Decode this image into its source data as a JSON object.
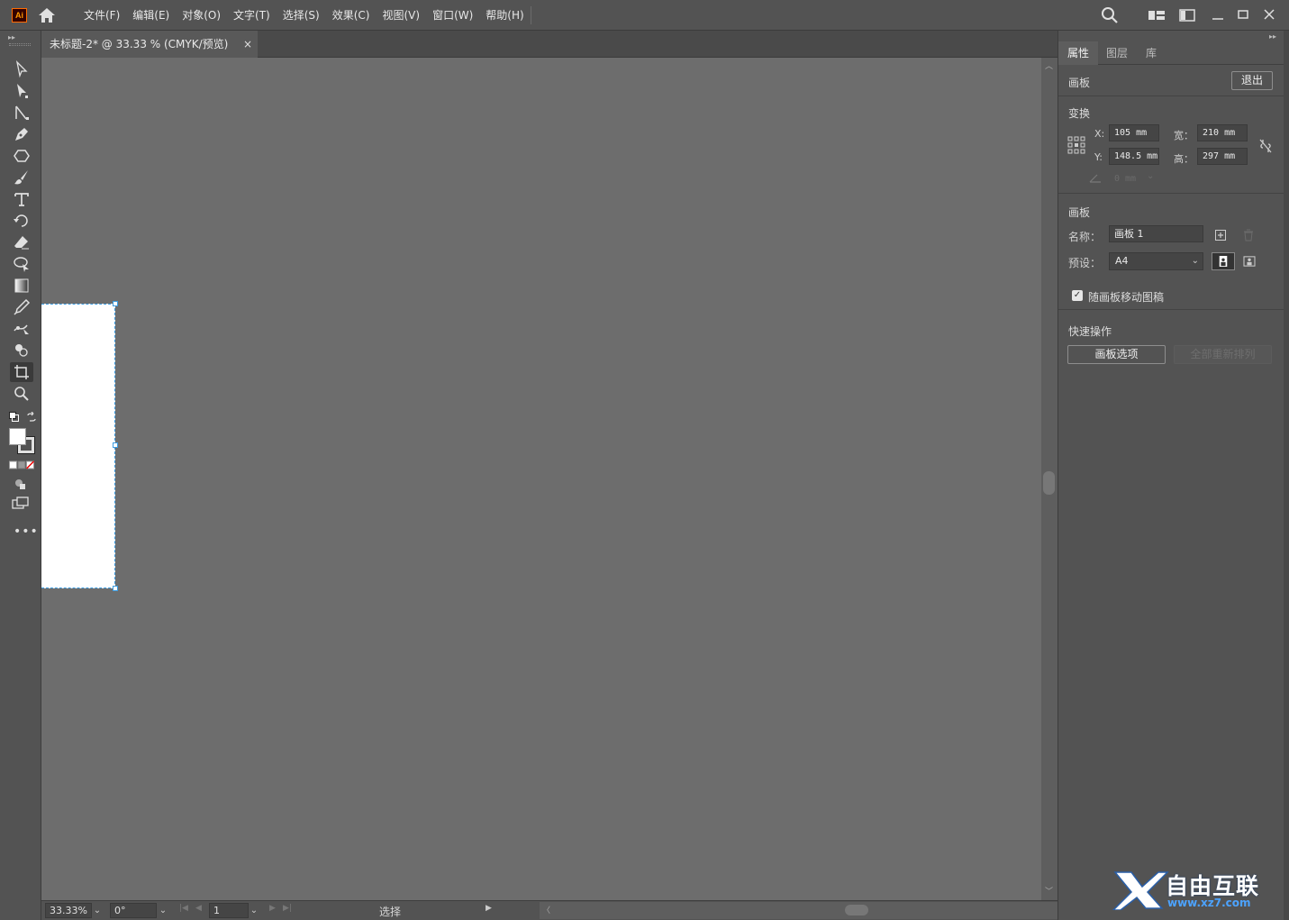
{
  "app": {
    "logo_text": "Ai"
  },
  "menu": {
    "items": [
      "文件(F)",
      "编辑(E)",
      "对象(O)",
      "文字(T)",
      "选择(S)",
      "效果(C)",
      "视图(V)",
      "窗口(W)",
      "帮助(H)"
    ]
  },
  "document_tab": {
    "title": "未标题-2* @ 33.33 % (CMYK/预览)",
    "close": "×"
  },
  "tools": [
    "selection-tool-icon",
    "direct-selection-tool-icon",
    "line-tool-icon",
    "pen-tool-icon",
    "polygon-tool-icon",
    "paintbrush-tool-icon",
    "type-tool-icon",
    "rotate-tool-icon",
    "eraser-tool-icon",
    "lasso-tool-icon",
    "gradient-tool-icon",
    "eyedropper-tool-icon",
    "puppet-warp-tool-icon",
    "shape-builder-tool-icon",
    "artboard-tool-icon",
    "zoom-tool-icon"
  ],
  "status": {
    "zoom": "33.33%",
    "rotation": "0°",
    "artboard_number": "1",
    "tool_name": "选择"
  },
  "panel": {
    "tabs": [
      "属性",
      "图层",
      "库"
    ],
    "artboard_header": {
      "title": "画板",
      "exit_button": "退出"
    },
    "transform": {
      "title": "变换",
      "x_label": "X:",
      "x_value": "105 mm",
      "y_label": "Y:",
      "y_value": "148.5 mm",
      "w_label": "宽：",
      "w_value": "210 mm",
      "h_label": "高：",
      "h_value": "297 mm",
      "angle_value": "0 mm"
    },
    "artboard": {
      "title": "画板",
      "name_label": "名称：",
      "name_value": "画板 1",
      "preset_label": "预设：",
      "preset_value": "A4"
    },
    "move_with_artboard": {
      "label": "随画板移动图稿",
      "checked": true
    },
    "quick_actions": {
      "title": "快速操作",
      "artboard_options": "画板选项",
      "rearrange_all": "全部重新排列"
    }
  },
  "watermark": {
    "text": "自由互联",
    "url": "www.xz7.com"
  },
  "colors": {
    "accent": "#3b9be0",
    "canvas": "#6d6d6d",
    "chrome": "#535353"
  }
}
